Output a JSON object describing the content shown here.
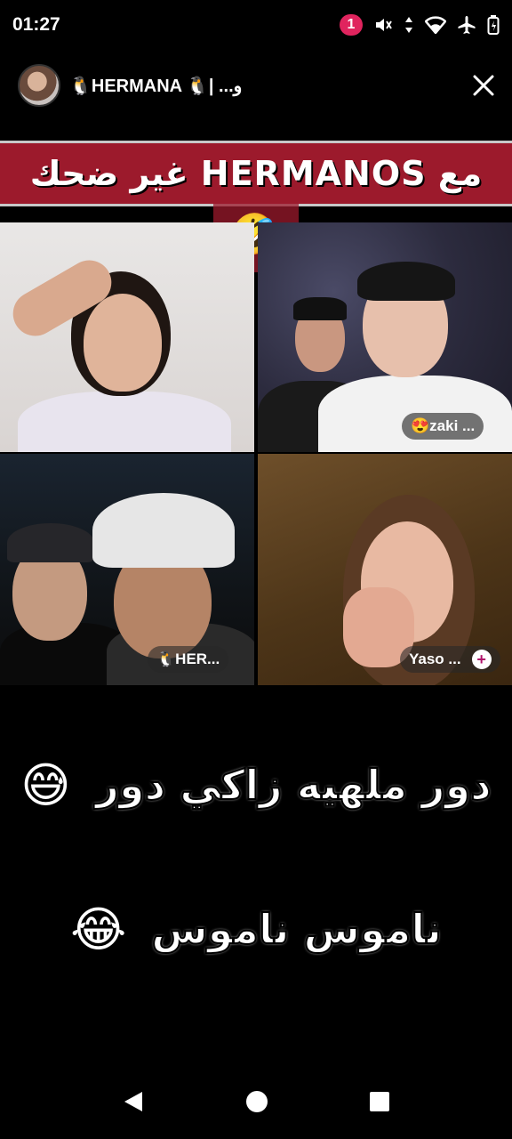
{
  "status_bar": {
    "time": "01:27",
    "notification_count": "1",
    "icons": [
      "mute-icon",
      "data-arrows-icon",
      "wifi-icon",
      "airplane-icon",
      "battery-icon"
    ]
  },
  "header": {
    "account_name": "🐧HERMANA 🐧| ...و",
    "close_icon": "close-icon"
  },
  "banner": {
    "text": "مع HERMANOS غير ضحك",
    "emoji": "🤣",
    "color": "#9c1a2c"
  },
  "participants": [
    {
      "name": ""
    },
    {
      "name": "😍zaki ..."
    },
    {
      "name": "🐧HER..."
    },
    {
      "name": "Yaso ...",
      "action_icon": "add-icon"
    }
  ],
  "captions": [
    {
      "text": "دور ملهيه زاكي دور",
      "emoji": "😅"
    },
    {
      "text": "ناموس ناموس",
      "emoji": "😂"
    }
  ],
  "nav_bar": {
    "icons": [
      "back-icon",
      "home-icon",
      "recents-icon"
    ]
  }
}
